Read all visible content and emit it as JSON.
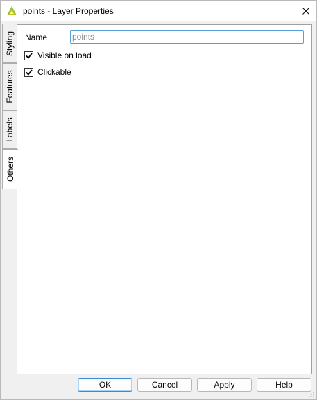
{
  "window": {
    "title": "points - Layer Properties"
  },
  "tabs": [
    {
      "label": "Styling",
      "active": false
    },
    {
      "label": "Features",
      "active": false
    },
    {
      "label": "Labels",
      "active": false
    },
    {
      "label": "Others",
      "active": true
    }
  ],
  "form": {
    "name_label": "Name",
    "name_value": "",
    "name_placeholder": "points",
    "visible_label": "Visible on load",
    "visible_checked": true,
    "clickable_label": "Clickable",
    "clickable_checked": true
  },
  "buttons": {
    "ok": "OK",
    "cancel": "Cancel",
    "apply": "Apply",
    "help": "Help"
  },
  "colors": {
    "accent": "#56a1d6",
    "icon_green": "#8cc63f",
    "icon_yellow": "#f2c200"
  }
}
